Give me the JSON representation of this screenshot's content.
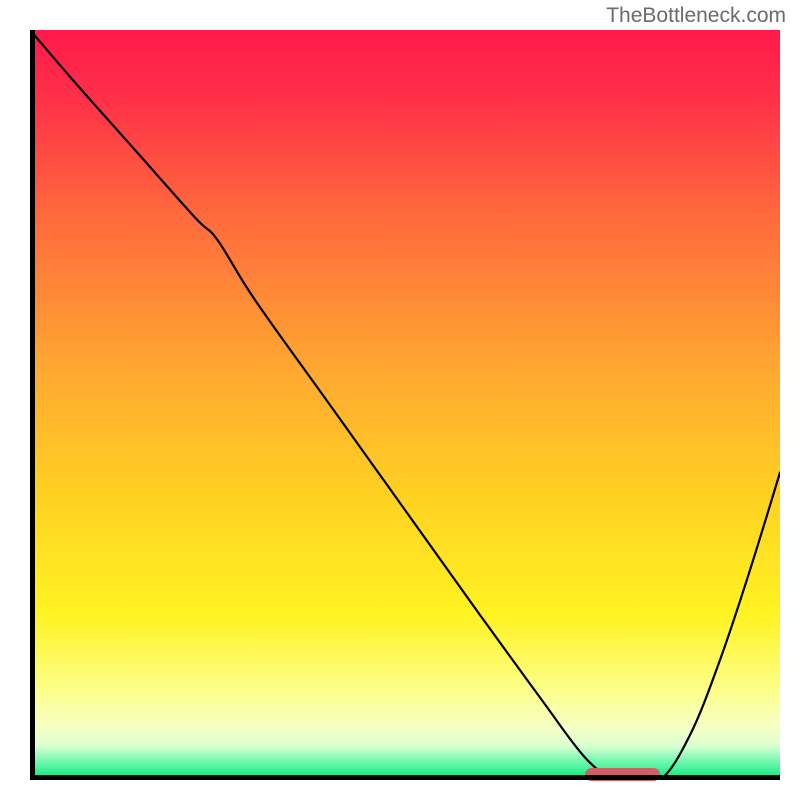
{
  "watermark": "TheBottleneck.com",
  "chart_data": {
    "type": "line",
    "title": "",
    "xlabel": "",
    "ylabel": "",
    "xlim": [
      0,
      100
    ],
    "ylim": [
      0,
      100
    ],
    "grid": false,
    "background": {
      "type": "vertical-gradient",
      "stops": [
        {
          "offset": 0.0,
          "color": "#ff1a4b"
        },
        {
          "offset": 0.09,
          "color": "#ff3048"
        },
        {
          "offset": 0.25,
          "color": "#ff6a3c"
        },
        {
          "offset": 0.45,
          "color": "#ffa731"
        },
        {
          "offset": 0.63,
          "color": "#ffd321"
        },
        {
          "offset": 0.78,
          "color": "#fff322"
        },
        {
          "offset": 0.88,
          "color": "#fcff89"
        },
        {
          "offset": 0.93,
          "color": "#f6ffc5"
        },
        {
          "offset": 0.955,
          "color": "#d9ffd0"
        },
        {
          "offset": 0.975,
          "color": "#72f8b0"
        },
        {
          "offset": 1.0,
          "color": "#00e77a"
        }
      ]
    },
    "series": [
      {
        "name": "bottleneck-curve",
        "color": "#000000",
        "stroke_width": 2.2,
        "x": [
          0,
          6,
          14,
          22,
          25,
          30,
          40,
          50,
          60,
          68,
          74,
          78,
          80,
          84,
          88,
          92,
          96,
          100
        ],
        "y": [
          100,
          93,
          84,
          75,
          72,
          64,
          50,
          36,
          22,
          11,
          3,
          0,
          0,
          0,
          6,
          16,
          28,
          41
        ]
      }
    ],
    "min_marker": {
      "x_start": 74,
      "x_end": 84,
      "y": 0.4,
      "color": "#cd6266"
    }
  }
}
